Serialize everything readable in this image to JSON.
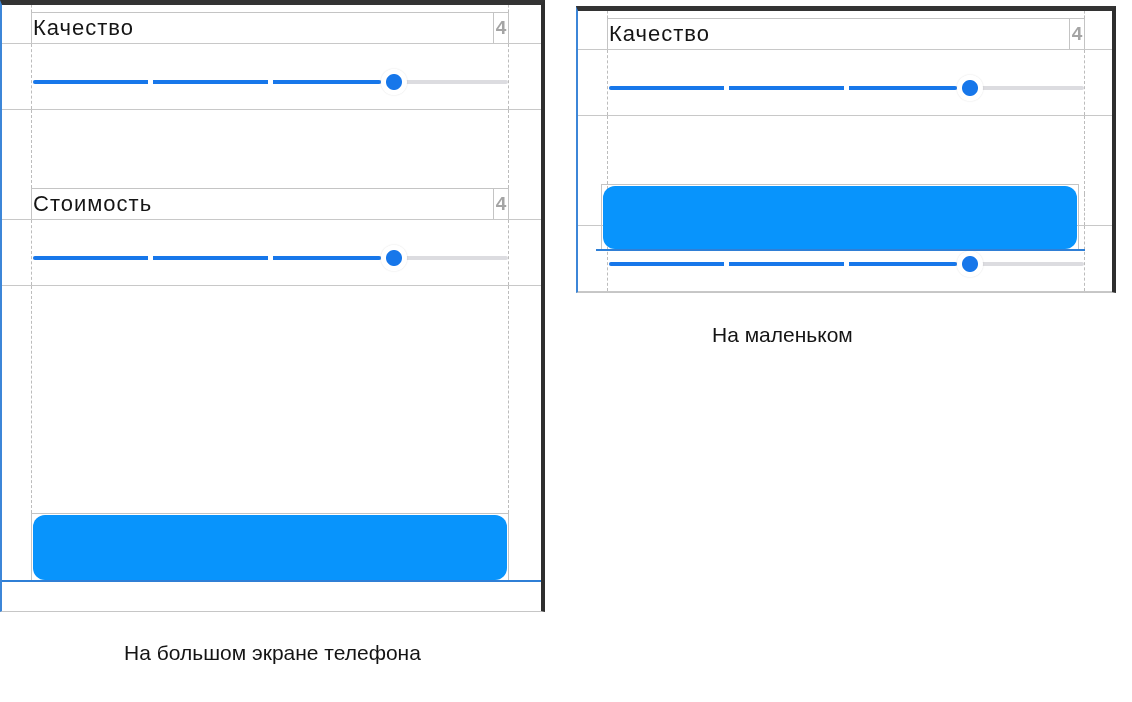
{
  "screens": [
    {
      "kind": "tall",
      "fields": [
        {
          "label": "Качество",
          "badge": "4",
          "level": 0.76
        },
        {
          "label": "Стоимость",
          "badge": "4",
          "level": 0.76
        }
      ],
      "caption": "На большом экране телефона"
    },
    {
      "kind": "short",
      "fields": [
        {
          "label": "Качество",
          "badge": "4",
          "level": 0.76
        },
        {
          "level": 0.76
        }
      ],
      "caption": "На маленьком"
    }
  ]
}
